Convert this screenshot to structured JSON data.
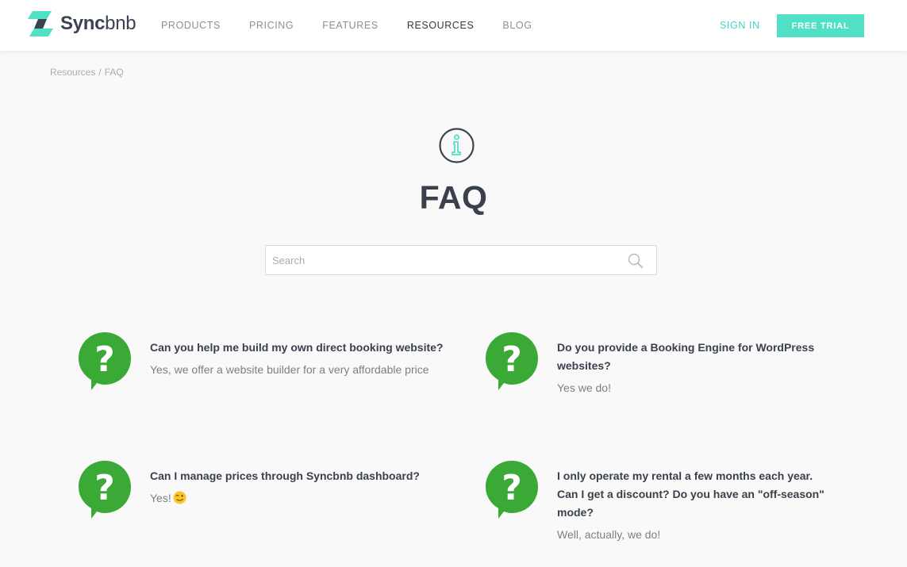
{
  "brand": {
    "name_bold": "Sync",
    "name_light": "bnb"
  },
  "nav": {
    "items": [
      {
        "label": "PRODUCTS"
      },
      {
        "label": "PRICING"
      },
      {
        "label": "FEATURES"
      },
      {
        "label": "RESOURCES",
        "active": true
      },
      {
        "label": "BLOG"
      }
    ],
    "sign_in": "SIGN IN",
    "free_trial": "FREE TRIAL"
  },
  "breadcrumb": {
    "parent": "Resources",
    "separator": "/",
    "current": "FAQ"
  },
  "page": {
    "title": "FAQ"
  },
  "search": {
    "placeholder": "Search"
  },
  "faq": [
    {
      "question": "Can you help me build my own direct booking website?",
      "answer": "Yes, we offer a website builder for a very affordable price"
    },
    {
      "question": "Do you provide a Booking Engine for WordPress websites?",
      "answer": "Yes we do!"
    },
    {
      "question": "Can I manage prices through Syncbnb dashboard?",
      "answer": "Yes!",
      "answer_icon": "winking-face-emoji"
    },
    {
      "question": "I only operate my rental a few months each year. Can I get a discount? Do you have an \"off-season\" mode?",
      "answer": "Well, actually, we do!"
    }
  ],
  "colors": {
    "accent": "#50e0c5",
    "question_bubble": "#3aa935",
    "title": "#3a414d"
  }
}
